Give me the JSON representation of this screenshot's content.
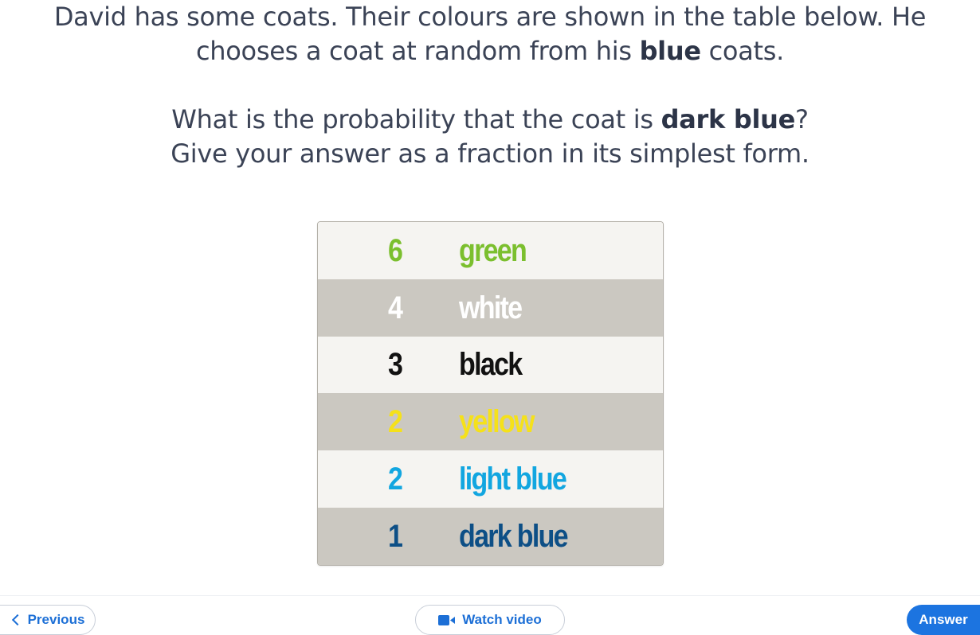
{
  "question": {
    "line1_before": "David has some coats. Their colours are shown in the table below. He",
    "line2_before": "chooses a coat at random from his ",
    "line2_bold": "blue",
    "line2_after": " coats.",
    "line3_before": "What is the probability that the coat is ",
    "line3_bold": "dark blue",
    "line3_after": "?",
    "line4": "Give your answer as a fraction in its simplest form."
  },
  "coats": [
    {
      "count": "6",
      "colour": "green",
      "text_color": "#7bbf2e"
    },
    {
      "count": "4",
      "colour": "white",
      "text_color": "#ffffff"
    },
    {
      "count": "3",
      "colour": "black",
      "text_color": "#111111"
    },
    {
      "count": "2",
      "colour": "yellow",
      "text_color": "#f5e11a"
    },
    {
      "count": "2",
      "colour": "light blue",
      "text_color": "#12a6e0"
    },
    {
      "count": "1",
      "colour": "dark blue",
      "text_color": "#0d4f86"
    }
  ],
  "nav": {
    "previous_label": "Previous",
    "watch_video_label": "Watch video",
    "answer_label": "Answer"
  },
  "icons": {
    "previous": "chevron-left-icon",
    "video": "video-camera-icon"
  },
  "colors": {
    "accent": "#1c74e0",
    "row_light": "#f5f4f1",
    "row_dark": "#cbc8c1"
  }
}
